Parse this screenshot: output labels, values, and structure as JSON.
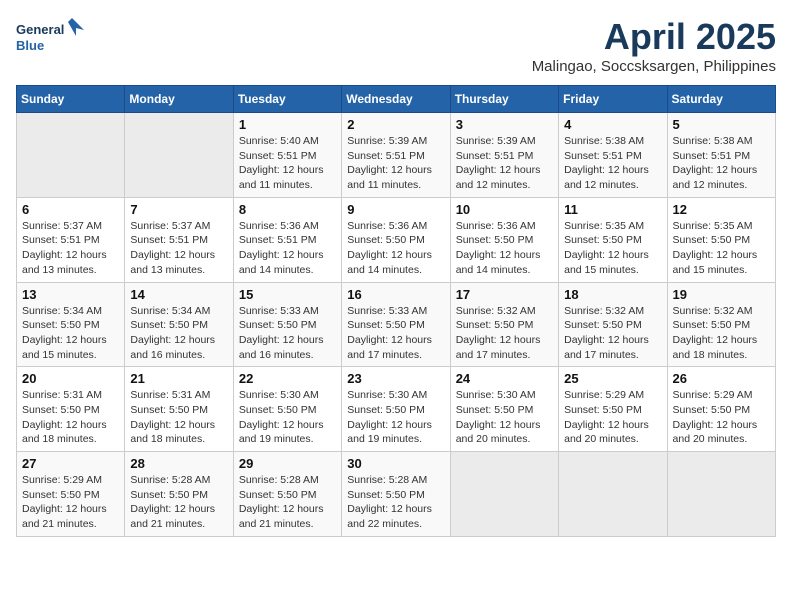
{
  "header": {
    "logo_line1": "General",
    "logo_line2": "Blue",
    "month": "April 2025",
    "location": "Malingao, Soccsksargen, Philippines"
  },
  "days_of_week": [
    "Sunday",
    "Monday",
    "Tuesday",
    "Wednesday",
    "Thursday",
    "Friday",
    "Saturday"
  ],
  "weeks": [
    [
      {
        "day": "",
        "info": ""
      },
      {
        "day": "",
        "info": ""
      },
      {
        "day": "1",
        "info": "Sunrise: 5:40 AM\nSunset: 5:51 PM\nDaylight: 12 hours\nand 11 minutes."
      },
      {
        "day": "2",
        "info": "Sunrise: 5:39 AM\nSunset: 5:51 PM\nDaylight: 12 hours\nand 11 minutes."
      },
      {
        "day": "3",
        "info": "Sunrise: 5:39 AM\nSunset: 5:51 PM\nDaylight: 12 hours\nand 12 minutes."
      },
      {
        "day": "4",
        "info": "Sunrise: 5:38 AM\nSunset: 5:51 PM\nDaylight: 12 hours\nand 12 minutes."
      },
      {
        "day": "5",
        "info": "Sunrise: 5:38 AM\nSunset: 5:51 PM\nDaylight: 12 hours\nand 12 minutes."
      }
    ],
    [
      {
        "day": "6",
        "info": "Sunrise: 5:37 AM\nSunset: 5:51 PM\nDaylight: 12 hours\nand 13 minutes."
      },
      {
        "day": "7",
        "info": "Sunrise: 5:37 AM\nSunset: 5:51 PM\nDaylight: 12 hours\nand 13 minutes."
      },
      {
        "day": "8",
        "info": "Sunrise: 5:36 AM\nSunset: 5:51 PM\nDaylight: 12 hours\nand 14 minutes."
      },
      {
        "day": "9",
        "info": "Sunrise: 5:36 AM\nSunset: 5:50 PM\nDaylight: 12 hours\nand 14 minutes."
      },
      {
        "day": "10",
        "info": "Sunrise: 5:36 AM\nSunset: 5:50 PM\nDaylight: 12 hours\nand 14 minutes."
      },
      {
        "day": "11",
        "info": "Sunrise: 5:35 AM\nSunset: 5:50 PM\nDaylight: 12 hours\nand 15 minutes."
      },
      {
        "day": "12",
        "info": "Sunrise: 5:35 AM\nSunset: 5:50 PM\nDaylight: 12 hours\nand 15 minutes."
      }
    ],
    [
      {
        "day": "13",
        "info": "Sunrise: 5:34 AM\nSunset: 5:50 PM\nDaylight: 12 hours\nand 15 minutes."
      },
      {
        "day": "14",
        "info": "Sunrise: 5:34 AM\nSunset: 5:50 PM\nDaylight: 12 hours\nand 16 minutes."
      },
      {
        "day": "15",
        "info": "Sunrise: 5:33 AM\nSunset: 5:50 PM\nDaylight: 12 hours\nand 16 minutes."
      },
      {
        "day": "16",
        "info": "Sunrise: 5:33 AM\nSunset: 5:50 PM\nDaylight: 12 hours\nand 17 minutes."
      },
      {
        "day": "17",
        "info": "Sunrise: 5:32 AM\nSunset: 5:50 PM\nDaylight: 12 hours\nand 17 minutes."
      },
      {
        "day": "18",
        "info": "Sunrise: 5:32 AM\nSunset: 5:50 PM\nDaylight: 12 hours\nand 17 minutes."
      },
      {
        "day": "19",
        "info": "Sunrise: 5:32 AM\nSunset: 5:50 PM\nDaylight: 12 hours\nand 18 minutes."
      }
    ],
    [
      {
        "day": "20",
        "info": "Sunrise: 5:31 AM\nSunset: 5:50 PM\nDaylight: 12 hours\nand 18 minutes."
      },
      {
        "day": "21",
        "info": "Sunrise: 5:31 AM\nSunset: 5:50 PM\nDaylight: 12 hours\nand 18 minutes."
      },
      {
        "day": "22",
        "info": "Sunrise: 5:30 AM\nSunset: 5:50 PM\nDaylight: 12 hours\nand 19 minutes."
      },
      {
        "day": "23",
        "info": "Sunrise: 5:30 AM\nSunset: 5:50 PM\nDaylight: 12 hours\nand 19 minutes."
      },
      {
        "day": "24",
        "info": "Sunrise: 5:30 AM\nSunset: 5:50 PM\nDaylight: 12 hours\nand 20 minutes."
      },
      {
        "day": "25",
        "info": "Sunrise: 5:29 AM\nSunset: 5:50 PM\nDaylight: 12 hours\nand 20 minutes."
      },
      {
        "day": "26",
        "info": "Sunrise: 5:29 AM\nSunset: 5:50 PM\nDaylight: 12 hours\nand 20 minutes."
      }
    ],
    [
      {
        "day": "27",
        "info": "Sunrise: 5:29 AM\nSunset: 5:50 PM\nDaylight: 12 hours\nand 21 minutes."
      },
      {
        "day": "28",
        "info": "Sunrise: 5:28 AM\nSunset: 5:50 PM\nDaylight: 12 hours\nand 21 minutes."
      },
      {
        "day": "29",
        "info": "Sunrise: 5:28 AM\nSunset: 5:50 PM\nDaylight: 12 hours\nand 21 minutes."
      },
      {
        "day": "30",
        "info": "Sunrise: 5:28 AM\nSunset: 5:50 PM\nDaylight: 12 hours\nand 22 minutes."
      },
      {
        "day": "",
        "info": ""
      },
      {
        "day": "",
        "info": ""
      },
      {
        "day": "",
        "info": ""
      }
    ]
  ]
}
